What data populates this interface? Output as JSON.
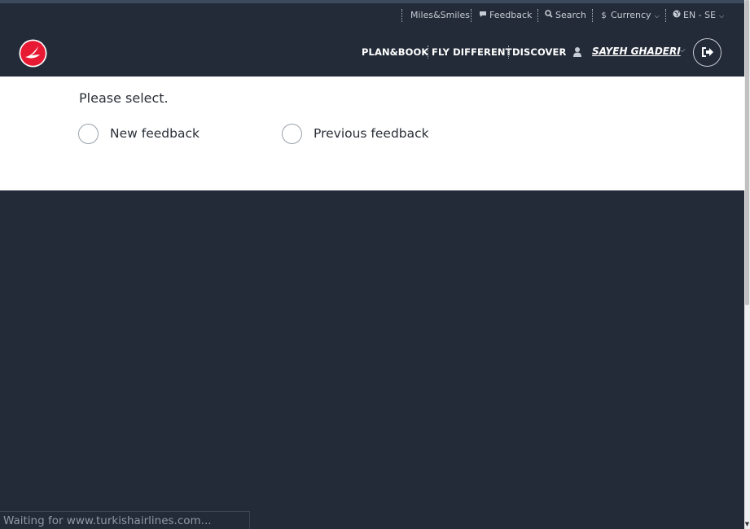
{
  "utility_bar": {
    "miles": "Miles&Smiles",
    "feedback": "Feedback",
    "search": "Search",
    "currency": "Currency",
    "language": "EN - SE"
  },
  "nav": {
    "plan_book": "PLAN&BOOK",
    "fly_different": "FLY DIFFERENT",
    "discover": "DISCOVER",
    "user_name": "SAYEH GHADERI"
  },
  "content": {
    "prompt": "Please select.",
    "options": [
      {
        "label": "New feedback",
        "selected": false
      },
      {
        "label": "Previous feedback",
        "selected": false
      }
    ]
  },
  "status": {
    "text": "Waiting for www.turkishairlines.com..."
  },
  "colors": {
    "header_bg": "#232b38",
    "brand_red": "#e81932",
    "content_bg": "#ffffff"
  }
}
